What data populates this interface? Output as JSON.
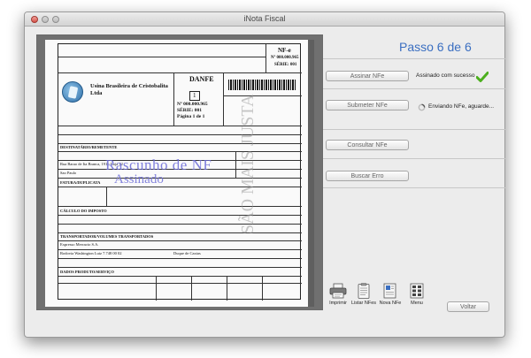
{
  "window": {
    "title": "iNota Fiscal"
  },
  "step": {
    "label": "Passo 6 de 6"
  },
  "actions": [
    {
      "label": "Assinar NFe",
      "status": "Assinado com sucesso"
    },
    {
      "label": "Submeter NFe",
      "status": "Enviando NFe, aguarde..."
    },
    {
      "label": "Consultar NFe",
      "status": ""
    },
    {
      "label": "Buscar Erro",
      "status": ""
    }
  ],
  "toolbar": {
    "items": [
      {
        "label": "Imprimir",
        "icon": "printer-icon"
      },
      {
        "label": "Listar NFes",
        "icon": "clipboard-list-icon"
      },
      {
        "label": "Nova NFe",
        "icon": "new-document-icon"
      },
      {
        "label": "Menu",
        "icon": "menu-grid-icon"
      }
    ],
    "back_label": "Voltar"
  },
  "document": {
    "nfe_label": "NF-e",
    "nfe_number": "Nº 000.000.965",
    "nfe_serie": "SÉRIE: 001",
    "company_name": "Usina Brasileira de Cristobalita Ltda",
    "danfe_title": "DANFE",
    "danfe_number": "Nº 000.000.965",
    "danfe_serie": "SÉRIE: 001",
    "danfe_page": "Página 1 de 1",
    "danfe_type": "1",
    "section_dest": "DESTINATÁRIO/REMETENTE",
    "section_fatura": "FATURA/DUPLICATA",
    "section_calculo": "CÁLCULO DO IMPOSTO",
    "section_transp": "TRANSPORTADOR/VOLUMES TRANSPORTADOS",
    "section_produtos": "DADOS PRODUTO/SERVIÇO",
    "transp_name": "Expresso Mercurio S.A.",
    "transp_addr": "Rodovia Washington Luiz 7.748 00 02",
    "transp_city": "Duque de Caxias",
    "dest_addr": "Rua Barao de Ita Branca, 191 - Loja 12",
    "dest_city": "Sao Paulo",
    "watermark_1": "Rascunho de NF",
    "watermark_2": "Assinado",
    "watermark_3": "SÃO MAIS JUSTA"
  },
  "colors": {
    "accent": "#3b6fc1",
    "check": "#4caf1e"
  }
}
